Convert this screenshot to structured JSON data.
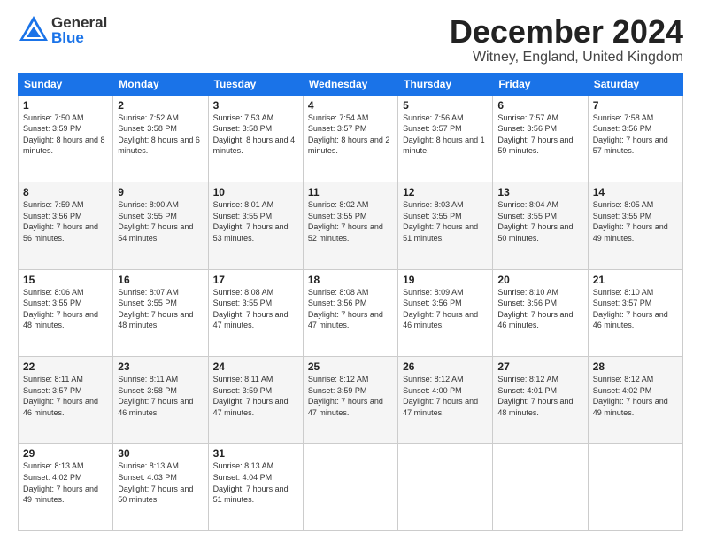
{
  "header": {
    "logo_general": "General",
    "logo_blue": "Blue",
    "title": "December 2024",
    "subtitle": "Witney, England, United Kingdom"
  },
  "columns": [
    "Sunday",
    "Monday",
    "Tuesday",
    "Wednesday",
    "Thursday",
    "Friday",
    "Saturday"
  ],
  "weeks": [
    [
      {
        "day": "1",
        "sunrise": "Sunrise: 7:50 AM",
        "sunset": "Sunset: 3:59 PM",
        "daylight": "Daylight: 8 hours and 8 minutes."
      },
      {
        "day": "2",
        "sunrise": "Sunrise: 7:52 AM",
        "sunset": "Sunset: 3:58 PM",
        "daylight": "Daylight: 8 hours and 6 minutes."
      },
      {
        "day": "3",
        "sunrise": "Sunrise: 7:53 AM",
        "sunset": "Sunset: 3:58 PM",
        "daylight": "Daylight: 8 hours and 4 minutes."
      },
      {
        "day": "4",
        "sunrise": "Sunrise: 7:54 AM",
        "sunset": "Sunset: 3:57 PM",
        "daylight": "Daylight: 8 hours and 2 minutes."
      },
      {
        "day": "5",
        "sunrise": "Sunrise: 7:56 AM",
        "sunset": "Sunset: 3:57 PM",
        "daylight": "Daylight: 8 hours and 1 minute."
      },
      {
        "day": "6",
        "sunrise": "Sunrise: 7:57 AM",
        "sunset": "Sunset: 3:56 PM",
        "daylight": "Daylight: 7 hours and 59 minutes."
      },
      {
        "day": "7",
        "sunrise": "Sunrise: 7:58 AM",
        "sunset": "Sunset: 3:56 PM",
        "daylight": "Daylight: 7 hours and 57 minutes."
      }
    ],
    [
      {
        "day": "8",
        "sunrise": "Sunrise: 7:59 AM",
        "sunset": "Sunset: 3:56 PM",
        "daylight": "Daylight: 7 hours and 56 minutes."
      },
      {
        "day": "9",
        "sunrise": "Sunrise: 8:00 AM",
        "sunset": "Sunset: 3:55 PM",
        "daylight": "Daylight: 7 hours and 54 minutes."
      },
      {
        "day": "10",
        "sunrise": "Sunrise: 8:01 AM",
        "sunset": "Sunset: 3:55 PM",
        "daylight": "Daylight: 7 hours and 53 minutes."
      },
      {
        "day": "11",
        "sunrise": "Sunrise: 8:02 AM",
        "sunset": "Sunset: 3:55 PM",
        "daylight": "Daylight: 7 hours and 52 minutes."
      },
      {
        "day": "12",
        "sunrise": "Sunrise: 8:03 AM",
        "sunset": "Sunset: 3:55 PM",
        "daylight": "Daylight: 7 hours and 51 minutes."
      },
      {
        "day": "13",
        "sunrise": "Sunrise: 8:04 AM",
        "sunset": "Sunset: 3:55 PM",
        "daylight": "Daylight: 7 hours and 50 minutes."
      },
      {
        "day": "14",
        "sunrise": "Sunrise: 8:05 AM",
        "sunset": "Sunset: 3:55 PM",
        "daylight": "Daylight: 7 hours and 49 minutes."
      }
    ],
    [
      {
        "day": "15",
        "sunrise": "Sunrise: 8:06 AM",
        "sunset": "Sunset: 3:55 PM",
        "daylight": "Daylight: 7 hours and 48 minutes."
      },
      {
        "day": "16",
        "sunrise": "Sunrise: 8:07 AM",
        "sunset": "Sunset: 3:55 PM",
        "daylight": "Daylight: 7 hours and 48 minutes."
      },
      {
        "day": "17",
        "sunrise": "Sunrise: 8:08 AM",
        "sunset": "Sunset: 3:55 PM",
        "daylight": "Daylight: 7 hours and 47 minutes."
      },
      {
        "day": "18",
        "sunrise": "Sunrise: 8:08 AM",
        "sunset": "Sunset: 3:56 PM",
        "daylight": "Daylight: 7 hours and 47 minutes."
      },
      {
        "day": "19",
        "sunrise": "Sunrise: 8:09 AM",
        "sunset": "Sunset: 3:56 PM",
        "daylight": "Daylight: 7 hours and 46 minutes."
      },
      {
        "day": "20",
        "sunrise": "Sunrise: 8:10 AM",
        "sunset": "Sunset: 3:56 PM",
        "daylight": "Daylight: 7 hours and 46 minutes."
      },
      {
        "day": "21",
        "sunrise": "Sunrise: 8:10 AM",
        "sunset": "Sunset: 3:57 PM",
        "daylight": "Daylight: 7 hours and 46 minutes."
      }
    ],
    [
      {
        "day": "22",
        "sunrise": "Sunrise: 8:11 AM",
        "sunset": "Sunset: 3:57 PM",
        "daylight": "Daylight: 7 hours and 46 minutes."
      },
      {
        "day": "23",
        "sunrise": "Sunrise: 8:11 AM",
        "sunset": "Sunset: 3:58 PM",
        "daylight": "Daylight: 7 hours and 46 minutes."
      },
      {
        "day": "24",
        "sunrise": "Sunrise: 8:11 AM",
        "sunset": "Sunset: 3:59 PM",
        "daylight": "Daylight: 7 hours and 47 minutes."
      },
      {
        "day": "25",
        "sunrise": "Sunrise: 8:12 AM",
        "sunset": "Sunset: 3:59 PM",
        "daylight": "Daylight: 7 hours and 47 minutes."
      },
      {
        "day": "26",
        "sunrise": "Sunrise: 8:12 AM",
        "sunset": "Sunset: 4:00 PM",
        "daylight": "Daylight: 7 hours and 47 minutes."
      },
      {
        "day": "27",
        "sunrise": "Sunrise: 8:12 AM",
        "sunset": "Sunset: 4:01 PM",
        "daylight": "Daylight: 7 hours and 48 minutes."
      },
      {
        "day": "28",
        "sunrise": "Sunrise: 8:12 AM",
        "sunset": "Sunset: 4:02 PM",
        "daylight": "Daylight: 7 hours and 49 minutes."
      }
    ],
    [
      {
        "day": "29",
        "sunrise": "Sunrise: 8:13 AM",
        "sunset": "Sunset: 4:02 PM",
        "daylight": "Daylight: 7 hours and 49 minutes."
      },
      {
        "day": "30",
        "sunrise": "Sunrise: 8:13 AM",
        "sunset": "Sunset: 4:03 PM",
        "daylight": "Daylight: 7 hours and 50 minutes."
      },
      {
        "day": "31",
        "sunrise": "Sunrise: 8:13 AM",
        "sunset": "Sunset: 4:04 PM",
        "daylight": "Daylight: 7 hours and 51 minutes."
      },
      null,
      null,
      null,
      null
    ]
  ]
}
